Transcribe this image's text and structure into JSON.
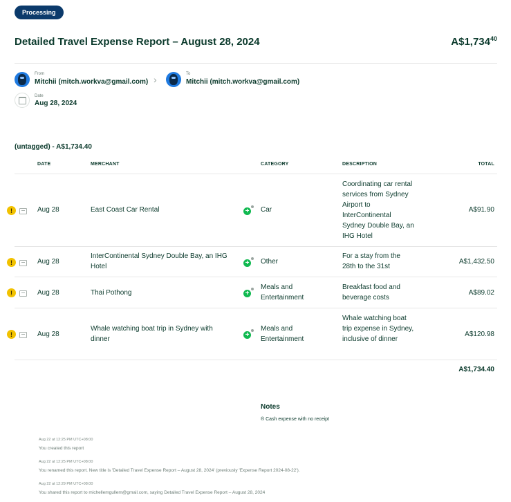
{
  "status_badge": "Processing",
  "report": {
    "title": "Detailed Travel Expense Report – August 28, 2024",
    "total_main": "A$1,734",
    "total_cents": "40"
  },
  "parties": {
    "from_label": "From",
    "from_value": "Mitchii (mitch.workva@gmail.com)",
    "to_label": "To",
    "to_value": "Mitchii (mitch.workva@gmail.com)",
    "date_label": "Date",
    "date_value": "Aug 28, 2024"
  },
  "group_label": "(untagged) - A$1,734.40",
  "table": {
    "headers": {
      "date": "DATE",
      "merchant": "MERCHANT",
      "category": "CATEGORY",
      "description": "DESCRIPTION",
      "total": "TOTAL"
    },
    "rows": [
      {
        "date": "Aug 28",
        "merchant": "East Coast Car Rental",
        "category": "Car",
        "description": "Coordinating car rental services from Sydney Airport to InterContinental Sydney Double Bay, an IHG Hotel",
        "total": "A$91.90"
      },
      {
        "date": "Aug 28",
        "merchant": "InterContinental Sydney Double Bay, an IHG Hotel",
        "category": "Other",
        "description": "For a stay from the 28th to the 31st",
        "total": "A$1,432.50"
      },
      {
        "date": "Aug 28",
        "merchant": "Thai Pothong",
        "category": "Meals and Entertainment",
        "description": "Breakfast food and beverage costs",
        "total": "A$89.02"
      },
      {
        "date": "Aug 28",
        "merchant": "Whale watching boat trip in Sydney with dinner",
        "category": "Meals and Entertainment",
        "description": "Whale watching boat trip expense in Sydney, inclusive of dinner",
        "total": "A$120.98"
      }
    ],
    "sum": "A$1,734.40"
  },
  "notes": {
    "title": "Notes",
    "items": [
      "Cash expense with no receipt"
    ]
  },
  "activity": [
    {
      "time": "Aug 22 at 12:25 PM UTC+08:00",
      "text": "You created this report"
    },
    {
      "time": "Aug 22 at 12:25 PM UTC+08:00",
      "text": "You renamed this report. New title is 'Detailed Travel Expense Report – August 28, 2024' (previously 'Expense Report 2024-08-22')."
    },
    {
      "time": "Aug 22 at 12:29 PM UTC+08:00",
      "text": "You shared this report to michellemgullem@gmail.com, saying Detailed Travel Expense Report – August 28, 2024"
    }
  ],
  "icons": {
    "warning": "!",
    "plus": "+",
    "arrow": "›",
    "note_bullet": "®"
  },
  "colors": {
    "badge": "#0b3a6b",
    "text": "#0b3a2c",
    "warning": "#f2c200",
    "category_plus": "#10b950"
  }
}
